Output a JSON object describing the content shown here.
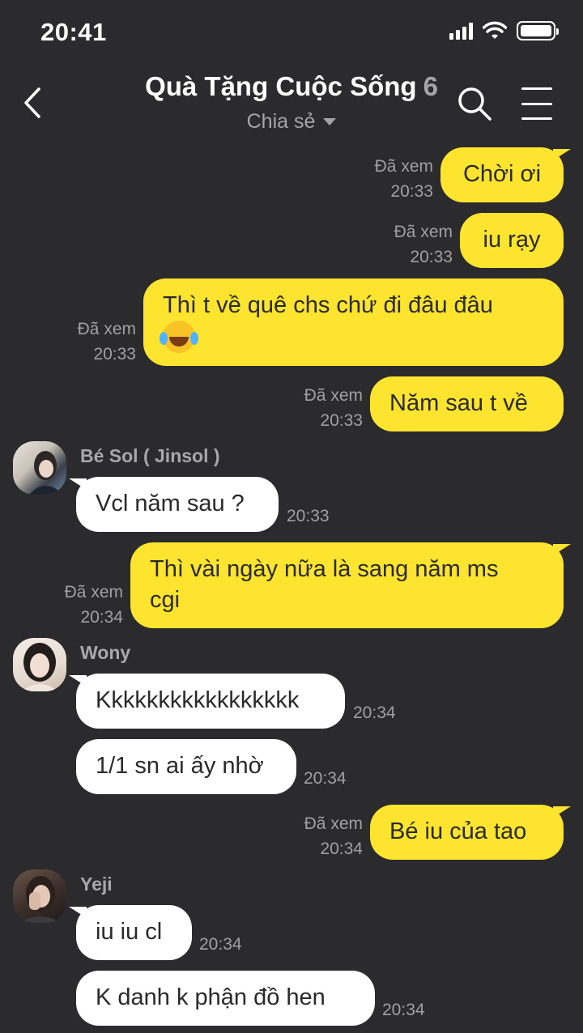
{
  "status": {
    "time": "20:41"
  },
  "header": {
    "title": "Quà Tặng Cuộc Sống",
    "member_count": "6",
    "subtitle": "Chia sẻ"
  },
  "messages": [
    {
      "text": "Chời ơi",
      "status": "Đã xem",
      "time": "20:33"
    },
    {
      "text": "iu rạy",
      "status": "Đã xem",
      "time": "20:33"
    },
    {
      "text_line1": "Thì t về quê chs chứ đi đâu đâu",
      "emoji": "joy-emoji",
      "status": "Đã xem",
      "time": "20:33"
    },
    {
      "text": "Năm sau t về",
      "status": "Đã xem",
      "time": "20:33"
    },
    {
      "sender": "Bé Sol ( Jinsol )",
      "text": "Vcl năm sau ?",
      "time": "20:33"
    },
    {
      "text_line1": "Thì vài ngày nữa là sang năm ms",
      "text_line2": "cgi",
      "status": "Đã xem",
      "time": "20:34"
    },
    {
      "sender": "Wony",
      "text": "Kkkkkkkkkkkkkkkkk",
      "time": "20:34"
    },
    {
      "text": "1/1 sn ai ấy nhờ",
      "time": "20:34"
    },
    {
      "text": "Bé iu của tao",
      "status": "Đã xem",
      "time": "20:34"
    },
    {
      "sender": "Yeji",
      "text": "iu iu cl",
      "time": "20:34"
    },
    {
      "text": "K danh k phận đồ hen",
      "time": "20:34"
    }
  ],
  "colors": {
    "background": "#2b2b2d",
    "outgoing_bubble": "#fde42f",
    "incoming_bubble": "#ffffff",
    "meta_text": "#a0a0a3"
  }
}
